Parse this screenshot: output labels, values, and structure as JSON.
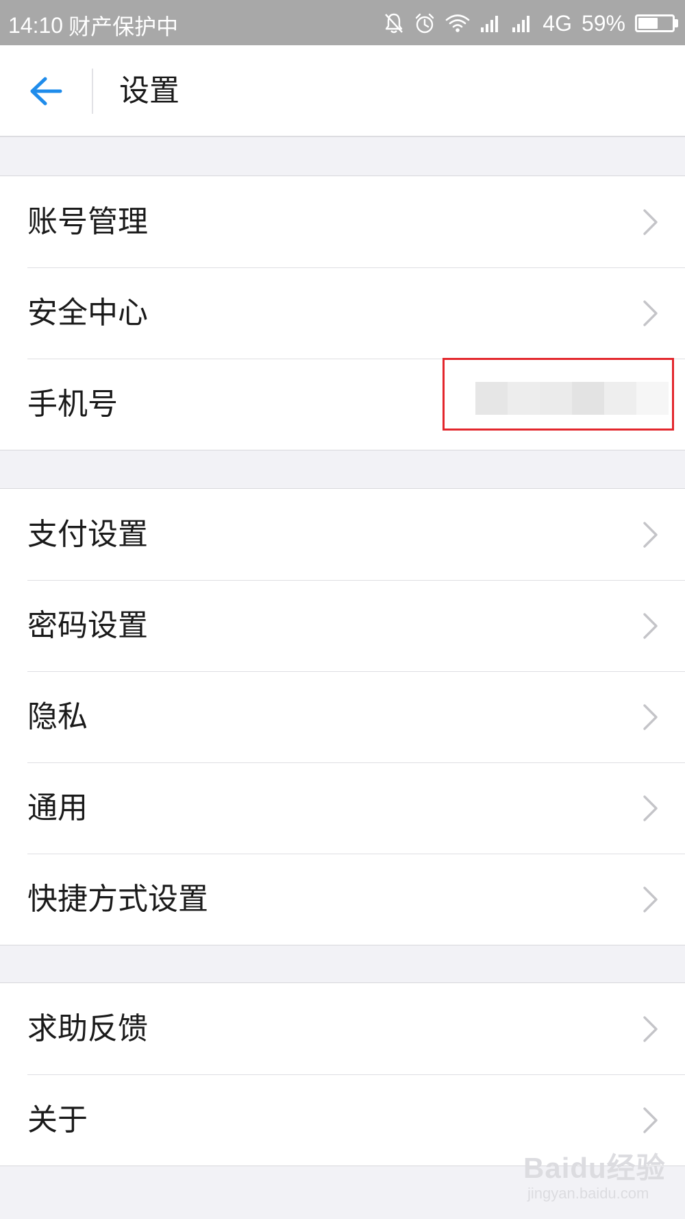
{
  "status_bar": {
    "time": "14:10",
    "notice": "财产保护中",
    "network": "4G",
    "battery_percent": "59%",
    "battery_level": 0.59,
    "icons": [
      "bell-muted-icon",
      "alarm-icon",
      "wifi-icon",
      "signal-icon",
      "signal-icon"
    ]
  },
  "header": {
    "title": "设置",
    "back_icon": "arrow-left-icon"
  },
  "settings": {
    "group1": [
      {
        "label": "账号管理"
      },
      {
        "label": "安全中心"
      },
      {
        "label": "手机号",
        "value": ""
      }
    ],
    "group2": [
      {
        "label": "支付设置"
      },
      {
        "label": "密码设置"
      },
      {
        "label": "隐私"
      },
      {
        "label": "通用"
      },
      {
        "label": "快捷方式设置"
      }
    ],
    "group3": [
      {
        "label": "求助反馈"
      },
      {
        "label": "关于"
      }
    ]
  },
  "watermark": {
    "logo": "Baidu经验",
    "url": "jingyan.baidu.com"
  },
  "colors": {
    "accent": "#1f8ceb",
    "highlight": "#e3262c",
    "status_bar": "#a8a8a8",
    "page_background": "#f2f2f6"
  }
}
